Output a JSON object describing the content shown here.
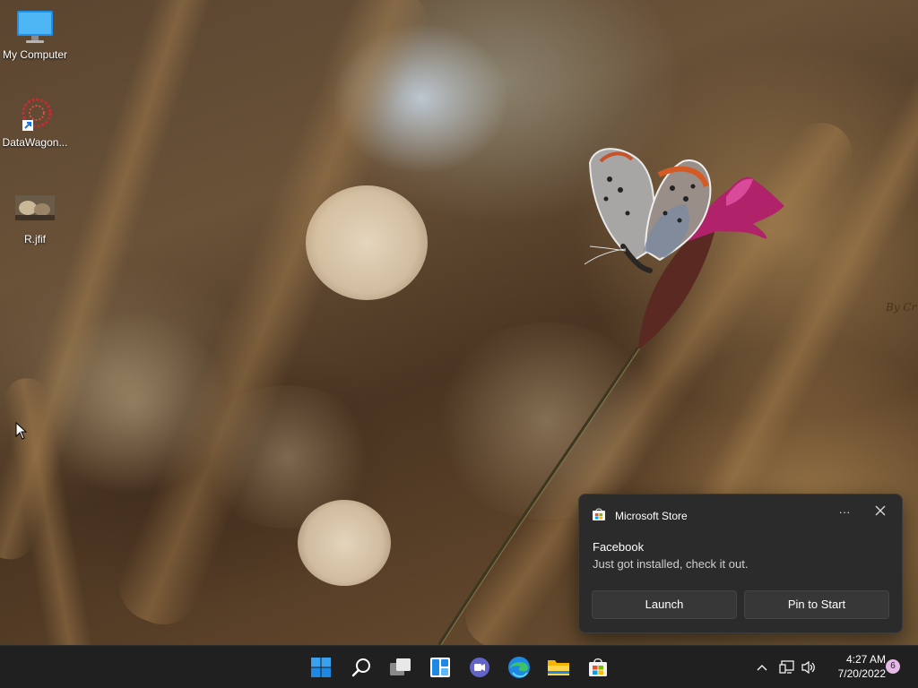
{
  "desktop": {
    "icons": [
      {
        "label": "My Computer",
        "icon": "monitor-icon"
      },
      {
        "label": "DataWagon...",
        "icon": "datawagon-shortcut-icon"
      },
      {
        "label": "R.jfif",
        "icon": "image-file-icon"
      }
    ],
    "watermark": "By Cr"
  },
  "toast": {
    "app_name": "Microsoft Store",
    "more_label": "···",
    "title": "Facebook",
    "message": "Just got installed, check it out.",
    "launch_label": "Launch",
    "pin_label": "Pin to Start"
  },
  "taskbar": {
    "apps": [
      "start-icon",
      "search-icon",
      "task-view-icon",
      "widgets-icon",
      "teams-chat-icon",
      "edge-icon",
      "file-explorer-icon",
      "microsoft-store-icon"
    ],
    "time": "4:27 AM",
    "date": "7/20/2022",
    "notification_count": "6"
  },
  "colors": {
    "taskbar_bg": "#202020",
    "toast_bg": "#2b2b2b",
    "windows_blue": "#1e9bf0",
    "badge": "#e7b9e6"
  }
}
